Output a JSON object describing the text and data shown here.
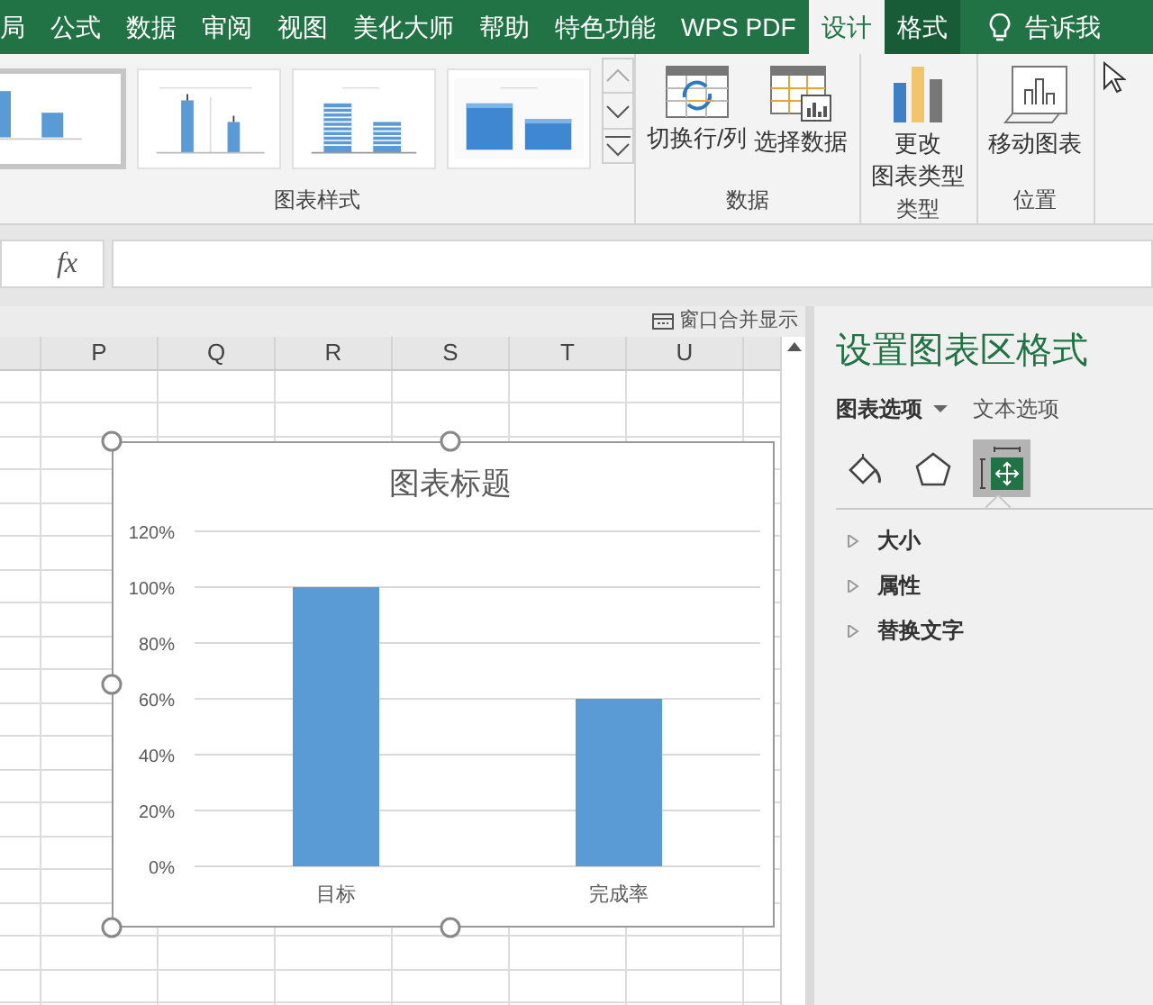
{
  "ribbon_tabs": [
    {
      "label": "局",
      "kind": "normal",
      "selected": false
    },
    {
      "label": "公式",
      "kind": "normal",
      "selected": false
    },
    {
      "label": "数据",
      "kind": "normal",
      "selected": false
    },
    {
      "label": "审阅",
      "kind": "normal",
      "selected": false
    },
    {
      "label": "视图",
      "kind": "normal",
      "selected": false
    },
    {
      "label": "美化大师",
      "kind": "normal",
      "selected": false
    },
    {
      "label": "帮助",
      "kind": "normal",
      "selected": false
    },
    {
      "label": "特色功能",
      "kind": "normal",
      "selected": false
    },
    {
      "label": "WPS PDF",
      "kind": "normal",
      "selected": false
    },
    {
      "label": "设计",
      "kind": "contextual",
      "selected": true
    },
    {
      "label": "格式",
      "kind": "contextual",
      "selected": false
    }
  ],
  "tell_me": {
    "label": "告诉我"
  },
  "ribbon_groups": [
    {
      "label": "图表样式",
      "kind": "gallery",
      "items": [
        {
          "kind": "plain",
          "selected": true
        },
        {
          "kind": "error_bars",
          "selected": false
        },
        {
          "kind": "striped",
          "selected": false
        },
        {
          "kind": "shaded",
          "selected": false
        }
      ]
    },
    {
      "label": "数据",
      "kind": "buttons",
      "buttons": [
        {
          "label": "切换行/列",
          "kind": "switch"
        },
        {
          "label": "选择数据",
          "kind": "select"
        }
      ]
    },
    {
      "label": "类型",
      "kind": "buttons",
      "buttons": [
        {
          "label_lines": [
            "更改",
            "图表类型"
          ],
          "kind": "change_type"
        }
      ]
    },
    {
      "label": "位置",
      "kind": "buttons",
      "buttons": [
        {
          "label": "移动图表",
          "kind": "move"
        }
      ]
    }
  ],
  "formula_bar": {
    "label": "fx"
  },
  "sheet": {
    "window_merge": "窗口合并显示",
    "columns": [
      "P",
      "Q",
      "R",
      "S",
      "T",
      "U"
    ],
    "chart": {
      "selected": true,
      "chart_data": {
        "type": "bar",
        "title": "图表标题",
        "categories": [
          "目标",
          "完成率"
        ],
        "grid": true,
        "series": [
          {
            "color": "#5b9bd5",
            "values": [
              1.0,
              0.6
            ]
          }
        ],
        "ylim": [
          0,
          1.2
        ],
        "yticks": [
          {
            "value": 0,
            "label": "0%"
          },
          {
            "value": 0.2,
            "label": "20%"
          },
          {
            "value": 0.4,
            "label": "40%"
          },
          {
            "value": 0.6,
            "label": "60%"
          },
          {
            "value": 0.8,
            "label": "80%"
          },
          {
            "value": 1.0,
            "label": "100%"
          },
          {
            "value": 1.2,
            "label": "120%"
          }
        ]
      }
    }
  },
  "format_pane": {
    "title": "设置图表区格式",
    "tabs": [
      {
        "label": "图表选项",
        "selected": true
      },
      {
        "label": "文本选项",
        "selected": false
      }
    ],
    "icon_tabs": [
      {
        "kind": "fill",
        "selected": false
      },
      {
        "kind": "effects",
        "selected": false
      },
      {
        "kind": "size",
        "selected": true
      }
    ],
    "sections": [
      {
        "label": "大小",
        "expanded": false
      },
      {
        "label": "属性",
        "expanded": false
      },
      {
        "label": "替换文字",
        "expanded": false
      }
    ]
  }
}
